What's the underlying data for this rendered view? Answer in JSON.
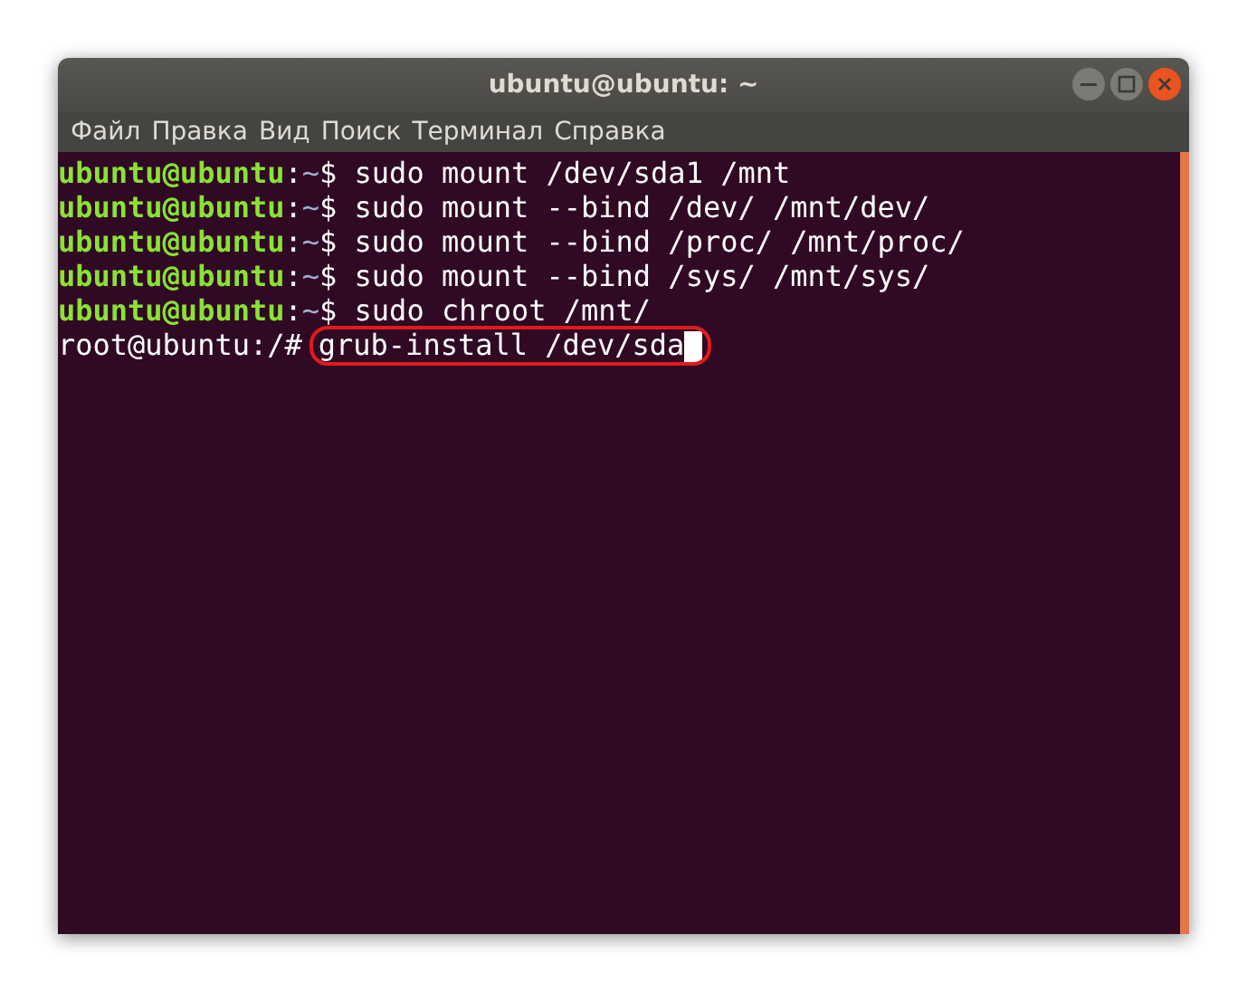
{
  "window": {
    "title": "ubuntu@ubuntu: ~"
  },
  "menu": [
    "Файл",
    "Правка",
    "Вид",
    "Поиск",
    "Терминал",
    "Справка"
  ],
  "lines": [
    {
      "kind": "user",
      "user": "ubuntu@ubuntu",
      "sep": ":",
      "dir": "~",
      "sign": "$",
      "command": "sudo mount /dev/sda1 /mnt",
      "highlighted": false,
      "cursor": false
    },
    {
      "kind": "user",
      "user": "ubuntu@ubuntu",
      "sep": ":",
      "dir": "~",
      "sign": "$",
      "command": "sudo mount --bind /dev/ /mnt/dev/",
      "highlighted": false,
      "cursor": false
    },
    {
      "kind": "user",
      "user": "ubuntu@ubuntu",
      "sep": ":",
      "dir": "~",
      "sign": "$",
      "command": "sudo mount --bind /proc/ /mnt/proc/",
      "highlighted": false,
      "cursor": false
    },
    {
      "kind": "user",
      "user": "ubuntu@ubuntu",
      "sep": ":",
      "dir": "~",
      "sign": "$",
      "command": "sudo mount --bind /sys/ /mnt/sys/",
      "highlighted": false,
      "cursor": false
    },
    {
      "kind": "user",
      "user": "ubuntu@ubuntu",
      "sep": ":",
      "dir": "~",
      "sign": "$",
      "command": "sudo chroot /mnt/",
      "highlighted": false,
      "cursor": false
    },
    {
      "kind": "root",
      "user": "root@ubuntu",
      "sep": ":",
      "dir": "/",
      "sign": "#",
      "command": "grub-install /dev/sda",
      "highlighted": true,
      "cursor": true
    }
  ]
}
